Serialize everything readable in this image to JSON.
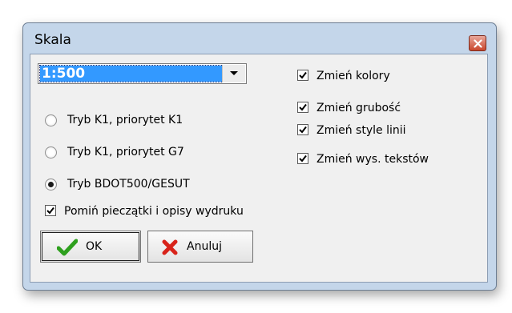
{
  "window": {
    "title": "Skala"
  },
  "scale_select": {
    "value": "1:500"
  },
  "modes": [
    {
      "label": "Tryb K1, priorytet K1",
      "selected": false
    },
    {
      "label": "Tryb K1, priorytet G7",
      "selected": false
    },
    {
      "label": "Tryb BDOT500/GESUT",
      "selected": true
    }
  ],
  "skip_stamps": {
    "label": "Pomiń pieczątki i opisy wydruku",
    "checked": true
  },
  "options": [
    {
      "label": "Zmień kolory",
      "checked": true
    },
    {
      "label": "Zmień grubość",
      "checked": true
    },
    {
      "label": "Zmień style linii",
      "checked": true
    },
    {
      "label": "Zmień wys. tekstów",
      "checked": true
    }
  ],
  "buttons": {
    "ok_label": "OK",
    "cancel_label": "Anuluj"
  },
  "colors": {
    "selection": "#3399ff",
    "ok_check": "#2ea01e",
    "cancel_x": "#d8231a",
    "frame": "#c4d6ea"
  },
  "icons": {
    "close": "close-icon",
    "dropdown": "chevron-down-icon",
    "ok": "checkmark-icon",
    "cancel": "x-icon"
  }
}
